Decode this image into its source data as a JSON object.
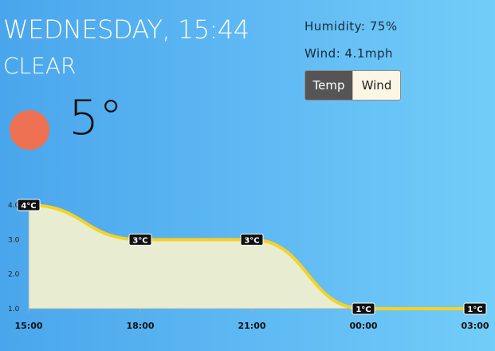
{
  "header": {
    "day_time": "WEDNESDAY, 15:44",
    "condition": "CLEAR",
    "temperature": "5°",
    "humidity": "Humidity: 75%",
    "wind": "Wind: 4.1mph"
  },
  "toggle": {
    "temp_label": "Temp",
    "wind_label": "Wind",
    "active": "Temp"
  },
  "icon": {
    "name": "sun-icon",
    "color": "#ef7153"
  },
  "chart_data": {
    "type": "area",
    "x": [
      "15:00",
      "18:00",
      "21:00",
      "00:00",
      "03:00"
    ],
    "values": [
      4,
      3,
      3,
      1,
      1
    ],
    "data_labels": [
      "4°C",
      "3°C",
      "3°C",
      "1°C",
      "1°C"
    ],
    "y_ticks": [
      "4.0",
      "3.0",
      "2.0",
      "1.0"
    ],
    "ylim": [
      1,
      4
    ],
    "line_color": "#f7d223",
    "fill_color": "#e8ecd0"
  }
}
